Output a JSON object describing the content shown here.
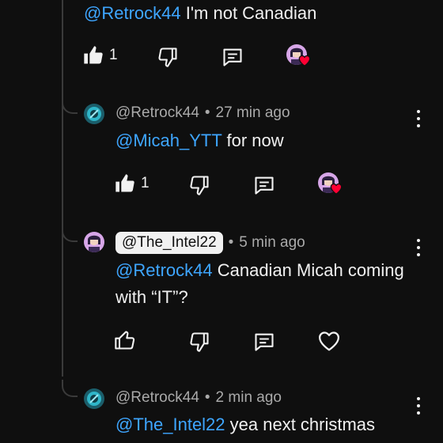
{
  "comments": [
    {
      "mention": "@Retrock44",
      "text": " I'm not Canadian",
      "likes": "1"
    },
    {
      "author": "@Retrock44",
      "time": "27 min ago",
      "mention": "@Micah_YTT",
      "text": " for now",
      "likes": "1"
    },
    {
      "author": "@The_Intel22",
      "time": "5 min ago",
      "mention": "@Retrock44",
      "text": " Canadian Micah coming with “IT”?"
    },
    {
      "author": "@Retrock44",
      "time": "2 min ago",
      "mention": "@The_Intel22",
      "text": " yea next christmas"
    }
  ],
  "separator": "•",
  "colors": {
    "background": "#0f0f0f",
    "text": "#f1f1f1",
    "secondary": "#aaaaaa",
    "mention": "#3ea6ff",
    "heart": "#ff0033"
  }
}
